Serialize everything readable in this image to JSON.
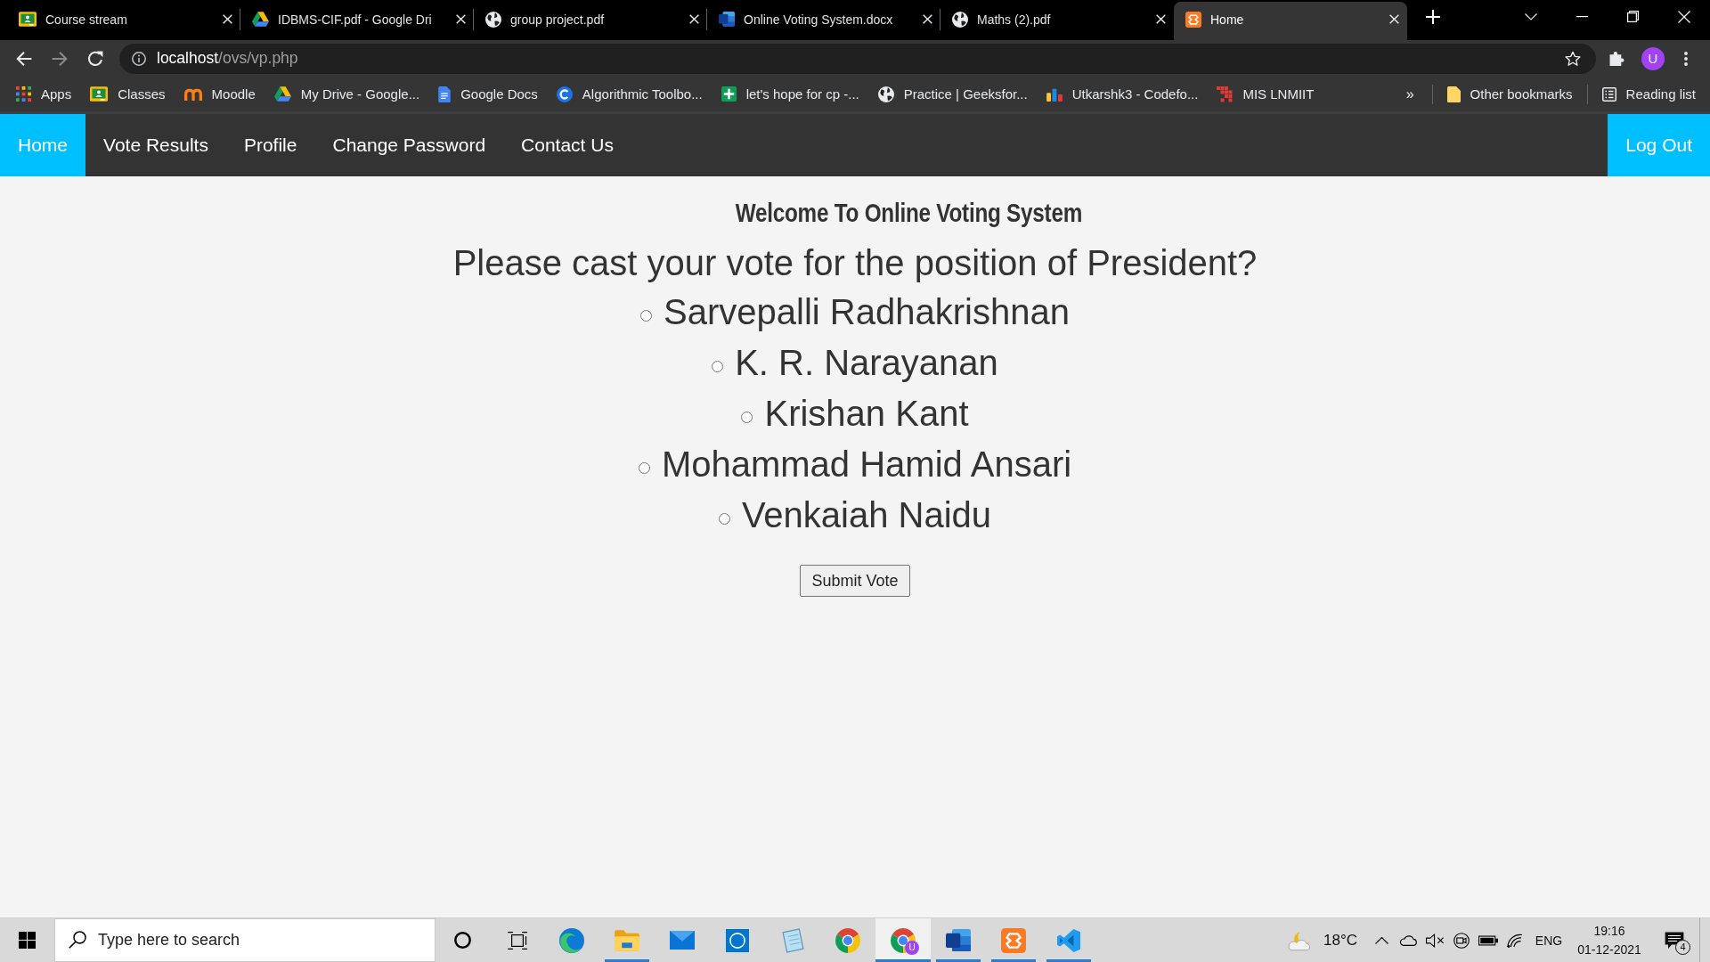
{
  "browser": {
    "tabs": [
      {
        "title": "Course stream",
        "selected": false
      },
      {
        "title": "IDBMS-CIF.pdf - Google Dri",
        "selected": false
      },
      {
        "title": "group project.pdf",
        "selected": false
      },
      {
        "title": "Online Voting System.docx",
        "selected": false
      },
      {
        "title": "Maths (2).pdf",
        "selected": false
      },
      {
        "title": "Home",
        "selected": true
      }
    ],
    "address": {
      "host": "localhost",
      "path": "/ovs/vp.php"
    },
    "profile": {
      "initial": "U"
    },
    "bookmarks": [
      {
        "label": "Apps"
      },
      {
        "label": "Classes"
      },
      {
        "label": "Moodle"
      },
      {
        "label": "My Drive - Google..."
      },
      {
        "label": "Google Docs"
      },
      {
        "label": "Algorithmic Toolbo..."
      },
      {
        "label": "let's hope for cp -..."
      },
      {
        "label": "Practice | Geeksfor..."
      },
      {
        "label": "Utkarshk3 - Codefo..."
      },
      {
        "label": "MIS LNMIIT"
      }
    ],
    "more_bookmarks": "»",
    "other_bookmarks": "Other bookmarks",
    "reading_list": "Reading list"
  },
  "navbar": {
    "links": [
      {
        "label": "Home",
        "selected": true
      },
      {
        "label": "Vote Results",
        "selected": false
      },
      {
        "label": "Profile",
        "selected": false
      },
      {
        "label": "Change Password",
        "selected": false
      },
      {
        "label": "Contact Us",
        "selected": false
      }
    ],
    "logout": "Log Out"
  },
  "page": {
    "heading": "Welcome To Online Voting System",
    "question": "Please cast your vote for the position of President?",
    "candidates": [
      {
        "name": "Sarvepalli Radhakrishnan",
        "selected": false
      },
      {
        "name": "K. R. Narayanan",
        "selected": false
      },
      {
        "name": "Krishan Kant",
        "selected": false
      },
      {
        "name": "Mohammad Hamid Ansari",
        "selected": false
      },
      {
        "name": "Venkaiah Naidu",
        "selected": false
      }
    ],
    "submit": "Submit Vote"
  },
  "taskbar": {
    "search": {
      "placeholder": "Type here to search"
    },
    "apps": [
      {
        "kind": "edge",
        "running": false,
        "selected": false
      },
      {
        "kind": "explorer",
        "running": true,
        "selected": false
      },
      {
        "kind": "mail",
        "running": false,
        "selected": false
      },
      {
        "kind": "dell",
        "running": false,
        "selected": false
      },
      {
        "kind": "notepad",
        "running": false,
        "selected": false
      },
      {
        "kind": "chrome",
        "running": false,
        "selected": false
      },
      {
        "kind": "chrome",
        "badge": "U",
        "running": true,
        "selected": true
      },
      {
        "kind": "word",
        "running": true,
        "selected": false
      },
      {
        "kind": "xampp",
        "running": true,
        "selected": false
      },
      {
        "kind": "vscode",
        "running": true,
        "selected": false
      }
    ],
    "weather": "18°C",
    "language": "ENG",
    "time": "19:16",
    "date": "01-12-2021",
    "notifications": "4"
  }
}
